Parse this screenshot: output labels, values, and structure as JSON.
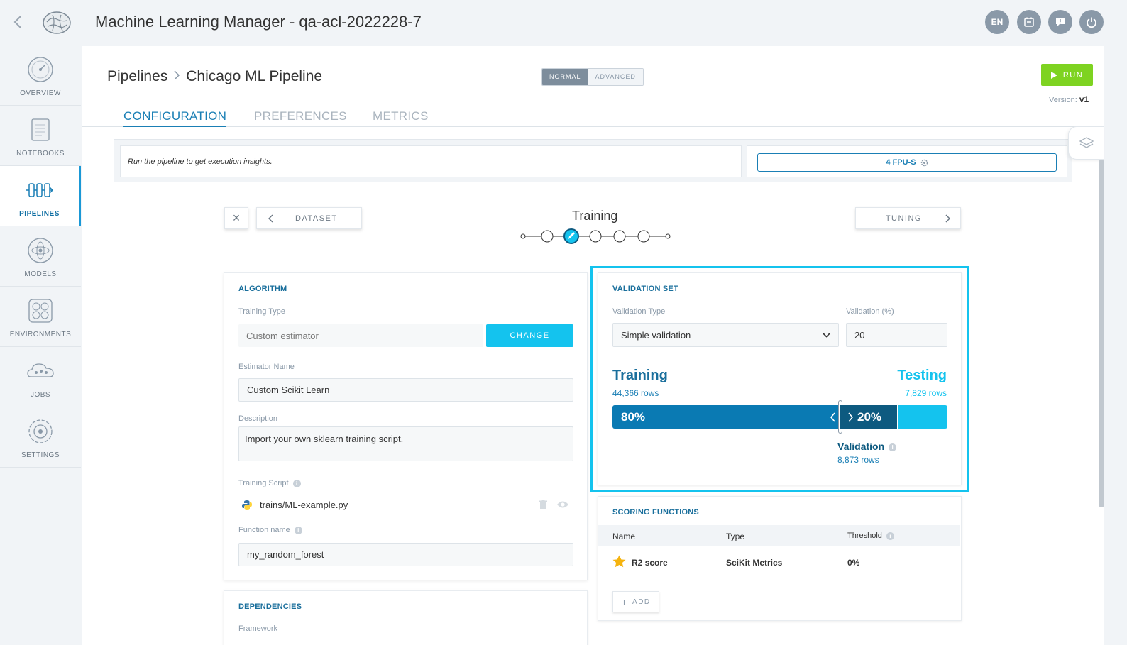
{
  "header": {
    "title": "Machine Learning Manager - qa-acl-2022228-7",
    "lang": "EN"
  },
  "sidebar": {
    "items": [
      {
        "label": "OVERVIEW"
      },
      {
        "label": "NOTEBOOKS"
      },
      {
        "label": "PIPELINES",
        "active": true
      },
      {
        "label": "MODELS"
      },
      {
        "label": "ENVIRONMENTS"
      },
      {
        "label": "JOBS"
      },
      {
        "label": "SETTINGS"
      }
    ]
  },
  "page": {
    "breadcrumb_root": "Pipelines",
    "breadcrumb_current": "Chicago ML Pipeline",
    "mode_normal": "NORMAL",
    "mode_advanced": "ADVANCED",
    "run_label": "RUN",
    "version_label": "Version:",
    "version_value": "v1",
    "tabs": [
      {
        "label": "CONFIGURATION",
        "active": true
      },
      {
        "label": "PREFERENCES"
      },
      {
        "label": "METRICS"
      }
    ],
    "insight_text": "Run the pipeline to get execution insights.",
    "fpu_label": "4 FPU-S"
  },
  "steps": {
    "close_label": "×",
    "prev_label": "DATASET",
    "next_label": "TUNING",
    "current_title": "Training",
    "current_index": 2,
    "count": 7
  },
  "algorithm": {
    "title": "ALGORITHM",
    "training_type_label": "Training Type",
    "training_type_value": "Custom estimator",
    "change_label": "CHANGE",
    "estimator_name_label": "Estimator Name",
    "estimator_name_value": "Custom Scikit Learn",
    "description_label": "Description",
    "description_value": "Import your own sklearn training script.",
    "training_script_label": "Training Script",
    "training_script_value": "trains/ML-example.py",
    "function_name_label": "Function name",
    "function_name_value": "my_random_forest"
  },
  "dependencies": {
    "title": "DEPENDENCIES",
    "framework_label": "Framework"
  },
  "validation": {
    "title": "VALIDATION SET",
    "type_label": "Validation Type",
    "type_value": "Simple validation",
    "percent_label": "Validation (%)",
    "percent_value": "20",
    "training_title": "Training",
    "training_rows": "44,366 rows",
    "testing_title": "Testing",
    "testing_rows": "7,829 rows",
    "training_pct": "80%",
    "validation_pct": "20%",
    "validation_title": "Validation",
    "validation_rows": "8,873 rows",
    "split": {
      "training": 0.68,
      "validation": 0.17,
      "testing": 0.15
    }
  },
  "scoring": {
    "title": "SCORING FUNCTIONS",
    "headers": [
      "Name",
      "Type",
      "Threshold"
    ],
    "rows": [
      {
        "name": "R2 score",
        "type": "SciKit Metrics",
        "threshold": "0%"
      }
    ],
    "add_label": "ADD"
  },
  "colors": {
    "accent": "#14c3ee",
    "primary": "#1a7fb5",
    "run": "#7ed321",
    "training_bar": "#0a7ab3",
    "validation_bar": "#0d5a80"
  }
}
